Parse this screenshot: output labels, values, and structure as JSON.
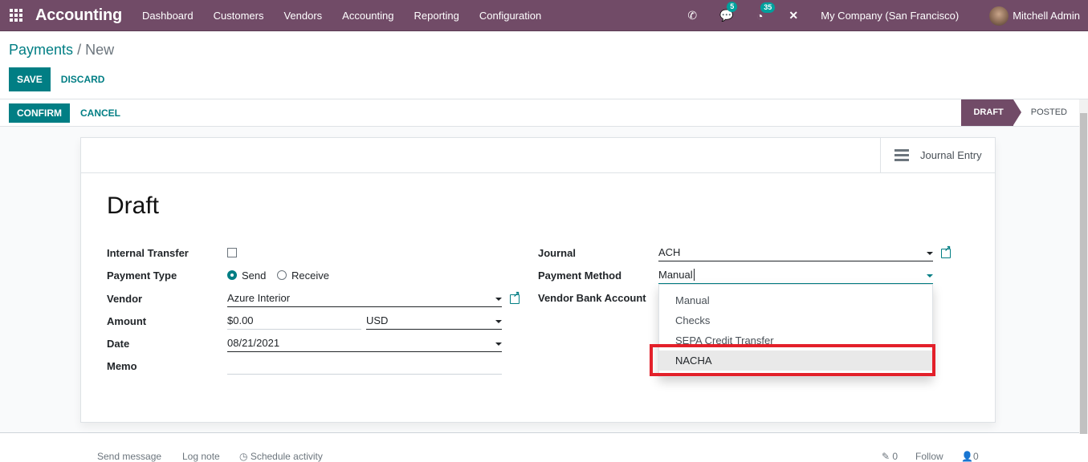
{
  "navbar": {
    "app_name": "Accounting",
    "menu": [
      "Dashboard",
      "Customers",
      "Vendors",
      "Accounting",
      "Reporting",
      "Configuration"
    ],
    "messages_count": "5",
    "activities_count": "35",
    "company": "My Company (San Francisco)",
    "user": "Mitchell Admin"
  },
  "breadcrumb": {
    "parent": "Payments",
    "separator": "/",
    "current": "New"
  },
  "actions": {
    "save": "SAVE",
    "discard": "DISCARD"
  },
  "statusbar": {
    "confirm": "CONFIRM",
    "cancel": "CANCEL",
    "stages": [
      "DRAFT",
      "POSTED"
    ],
    "active_stage": "DRAFT"
  },
  "smart_button": {
    "label": "Journal Entry"
  },
  "form": {
    "title": "Draft",
    "internal_transfer": {
      "label": "Internal Transfer",
      "checked": false
    },
    "payment_type": {
      "label": "Payment Type",
      "options": [
        "Send",
        "Receive"
      ],
      "selected": "Send"
    },
    "vendor": {
      "label": "Vendor",
      "value": "Azure Interior"
    },
    "amount": {
      "label": "Amount",
      "value": "$0.00",
      "currency": "USD"
    },
    "date": {
      "label": "Date",
      "value": "08/21/2021"
    },
    "memo": {
      "label": "Memo",
      "value": ""
    },
    "journal": {
      "label": "Journal",
      "value": "ACH"
    },
    "payment_method": {
      "label": "Payment Method",
      "value": "Manual"
    },
    "vendor_bank_account": {
      "label": "Vendor Bank Account"
    }
  },
  "payment_method_dropdown": {
    "options": [
      "Manual",
      "Checks",
      "SEPA Credit Transfer",
      "NACHA"
    ],
    "highlighted": "NACHA"
  },
  "chatter": {
    "send_message": "Send message",
    "log_note": "Log note",
    "schedule_activity": "Schedule activity",
    "attachments": "0",
    "follow": "Follow",
    "followers": "0"
  },
  "colors": {
    "brand": "#714b67",
    "accent": "#017e84",
    "highlight_box": "#e3202a"
  }
}
